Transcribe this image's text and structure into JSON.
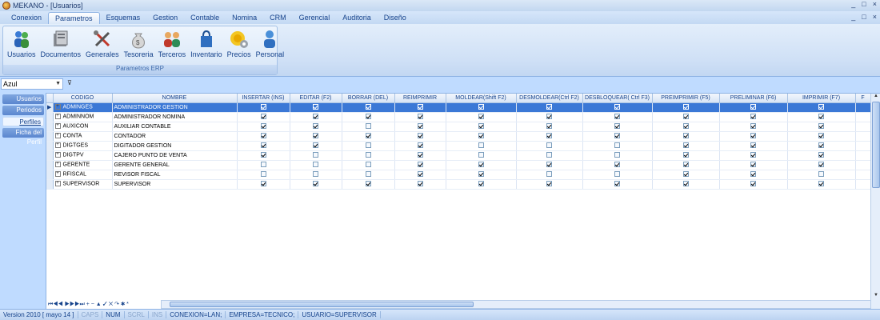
{
  "window": {
    "title": "MEKANO - [Usuarios]",
    "controls": [
      "_",
      "□",
      "×"
    ]
  },
  "menu": {
    "tabs": [
      "Conexion",
      "Parametros",
      "Esquemas",
      "Gestion",
      "Contable",
      "Nomina",
      "CRM",
      "Gerencial",
      "Auditoria",
      "Diseño"
    ],
    "active": "Parametros",
    "mdi_controls": [
      "_",
      "□",
      "×"
    ]
  },
  "ribbon": {
    "group_name": "Parametros ERP",
    "buttons": [
      {
        "label": "Usuarios",
        "icon": "users-icon"
      },
      {
        "label": "Documentos",
        "icon": "documents-icon"
      },
      {
        "label": "Generales",
        "icon": "tools-icon"
      },
      {
        "label": "Tesoreria",
        "icon": "money-bag-icon"
      },
      {
        "label": "Terceros",
        "icon": "people-icon"
      },
      {
        "label": "Inventario",
        "icon": "shopping-bag-icon"
      },
      {
        "label": "Precios",
        "icon": "price-gear-icon"
      },
      {
        "label": "Personal",
        "icon": "person-icon"
      }
    ]
  },
  "theme_select": {
    "value": "Azul"
  },
  "leftnav": {
    "items": [
      "Usuarios",
      "Periodos",
      "Perfiles",
      "Ficha del Perfil"
    ],
    "selected": "Perfiles"
  },
  "grid": {
    "columns": [
      "CODIGO",
      "NOMBRE",
      "INSERTAR (INS)",
      "EDITAR (F2)",
      "BORRAR (DEL)",
      "REIMPRIMIR",
      "MOLDEAR(Shift F2)",
      "DESMOLDEAR(Ctrl F2)",
      "DESBLOQUEAR( Ctrl F3)",
      "PREIMPRIMIR (F5)",
      "PRELIMINAR (F6)",
      "IMPRIMIR (F7)",
      "F"
    ],
    "rows": [
      {
        "code": "ADMINGES",
        "name": "ADMINISTRADOR GESTION",
        "checks": [
          1,
          1,
          1,
          1,
          1,
          1,
          1,
          1,
          1,
          1
        ],
        "selected": true
      },
      {
        "code": "ADMINNOM",
        "name": "ADMINISTRADOR NOMINA",
        "checks": [
          1,
          1,
          1,
          1,
          1,
          1,
          1,
          1,
          1,
          1
        ]
      },
      {
        "code": "AUXICON",
        "name": "AUXILIAR CONTABLE",
        "checks": [
          1,
          1,
          0,
          1,
          1,
          1,
          1,
          1,
          1,
          1
        ]
      },
      {
        "code": "CONTA",
        "name": "CONTADOR",
        "checks": [
          1,
          1,
          1,
          1,
          1,
          1,
          1,
          1,
          1,
          1
        ]
      },
      {
        "code": "DIGTGES",
        "name": "DIGITADOR GESTION",
        "checks": [
          1,
          1,
          0,
          1,
          0,
          0,
          0,
          1,
          1,
          1
        ]
      },
      {
        "code": "DIGTPV",
        "name": "CAJERO PUNTO DE VENTA",
        "checks": [
          1,
          0,
          0,
          1,
          0,
          0,
          0,
          1,
          1,
          1
        ]
      },
      {
        "code": "GERENTE",
        "name": "GERENTE GENERAL",
        "checks": [
          0,
          0,
          0,
          1,
          1,
          1,
          1,
          1,
          1,
          1
        ]
      },
      {
        "code": "RFISCAL",
        "name": "REVISOR FISCAL",
        "checks": [
          0,
          0,
          0,
          1,
          1,
          0,
          0,
          1,
          1,
          0
        ]
      },
      {
        "code": "SUPERVISOR",
        "name": "SUPERVISOR",
        "checks": [
          1,
          1,
          1,
          1,
          1,
          1,
          1,
          1,
          1,
          1
        ]
      }
    ],
    "navigator": "⏮◀◀ ▶▶▶⏭ + − ▲ ✓ ✕ ↷ ✱ *"
  },
  "status": {
    "version": "Version 2010 [ mayo 14 ]",
    "caps": "CAPS",
    "num": "NUM",
    "scrl": "SCRL",
    "ins": "INS",
    "conexion": "CONEXION=LAN;",
    "empresa": "EMPRESA=TECNICO;",
    "usuario": "USUARIO=SUPERVISOR"
  },
  "colors": {
    "accent": "#3b78d6",
    "ribbon_bg": "#dbe8f8",
    "nav_blue": "#5a86cf"
  }
}
